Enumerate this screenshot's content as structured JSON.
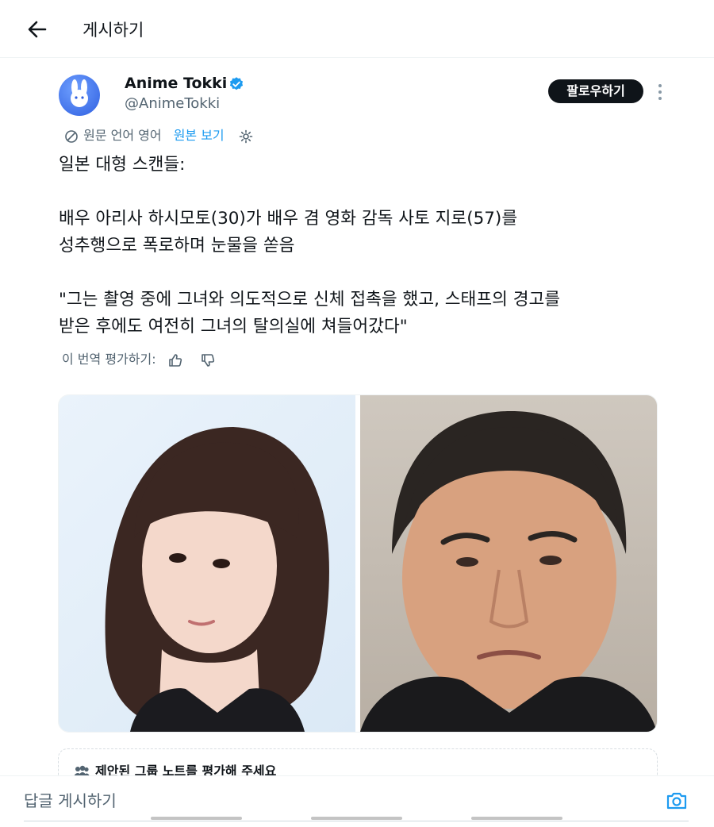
{
  "header": {
    "back_icon": "arrow-left-icon",
    "title": "게시하기"
  },
  "author": {
    "display_name": "Anime Tokki",
    "handle": "@AnimeTokki",
    "verified": true,
    "verified_color": "#1d9bf0",
    "avatar_icon": "rabbit-logo-icon"
  },
  "actions": {
    "follow_label": "팔로우하기",
    "more_icon": "more-vertical-icon"
  },
  "translation": {
    "label": "원문 언어 영어",
    "view_original": "원본 보기",
    "translate_icon": "translate-icon",
    "settings_icon": "gear-icon"
  },
  "tweet": {
    "line1": "일본 대형 스캔들:",
    "line2": "배우 아리사 하시모토(30)가 배우 겸 영화 감독 사토 지로(57)를",
    "line3": "성추행으로 폭로하며 눈물을 쏟음",
    "line4": "\"그는 촬영 중에 그녀와 의도적으로 신체 접촉을 했고, 스태프의 경고를",
    "line5": "받은 후에도 여전히 그녀의 탈의실에 쳐들어갔다\""
  },
  "rate_translation": {
    "label": "이 번역 평가하기:",
    "like_icon": "thumbs-up-icon",
    "dislike_icon": "thumbs-down-icon"
  },
  "media": {
    "left_photo": "woman-portrait-photo",
    "right_photo": "man-portrait-photo"
  },
  "community_notes": {
    "icon": "people-icon",
    "text": "제안된 그룹 노트를 평가해 주세요"
  },
  "reply": {
    "placeholder": "답글 게시하기",
    "camera_icon": "camera-icon"
  },
  "colors": {
    "accent": "#1d9bf0",
    "text": "#0f1419",
    "muted": "#536471",
    "button_dark": "#0f1419"
  }
}
